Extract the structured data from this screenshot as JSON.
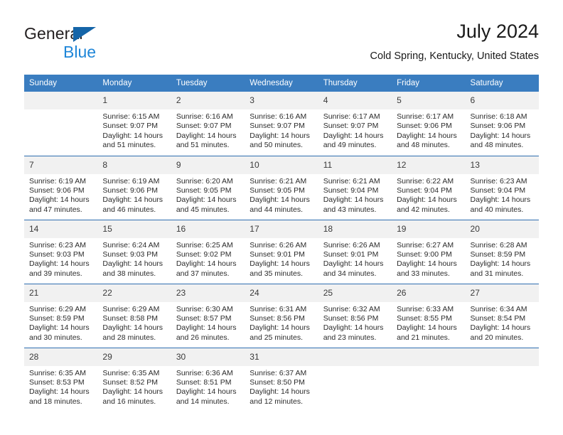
{
  "brand": {
    "name_part1": "General",
    "name_part2": "Blue",
    "triangle_color": "#1565a8",
    "blue_color": "#1f86d8"
  },
  "header": {
    "title": "July 2024",
    "subtitle": "Cold Spring, Kentucky, United States"
  },
  "theme": {
    "header_bg": "#3a7dc0",
    "row_divider": "#2f6eb0",
    "daynum_bg": "#f1f1f1",
    "text": "#2b2b2b"
  },
  "calendar": {
    "weekday_headers": [
      "Sunday",
      "Monday",
      "Tuesday",
      "Wednesday",
      "Thursday",
      "Friday",
      "Saturday"
    ],
    "weeks": [
      [
        {
          "day": "",
          "sunrise": "",
          "sunset": "",
          "daylight_line1": "",
          "daylight_line2": "",
          "empty": true
        },
        {
          "day": "1",
          "sunrise": "Sunrise: 6:15 AM",
          "sunset": "Sunset: 9:07 PM",
          "daylight_line1": "Daylight: 14 hours",
          "daylight_line2": "and 51 minutes."
        },
        {
          "day": "2",
          "sunrise": "Sunrise: 6:16 AM",
          "sunset": "Sunset: 9:07 PM",
          "daylight_line1": "Daylight: 14 hours",
          "daylight_line2": "and 51 minutes."
        },
        {
          "day": "3",
          "sunrise": "Sunrise: 6:16 AM",
          "sunset": "Sunset: 9:07 PM",
          "daylight_line1": "Daylight: 14 hours",
          "daylight_line2": "and 50 minutes."
        },
        {
          "day": "4",
          "sunrise": "Sunrise: 6:17 AM",
          "sunset": "Sunset: 9:07 PM",
          "daylight_line1": "Daylight: 14 hours",
          "daylight_line2": "and 49 minutes."
        },
        {
          "day": "5",
          "sunrise": "Sunrise: 6:17 AM",
          "sunset": "Sunset: 9:06 PM",
          "daylight_line1": "Daylight: 14 hours",
          "daylight_line2": "and 48 minutes."
        },
        {
          "day": "6",
          "sunrise": "Sunrise: 6:18 AM",
          "sunset": "Sunset: 9:06 PM",
          "daylight_line1": "Daylight: 14 hours",
          "daylight_line2": "and 48 minutes."
        }
      ],
      [
        {
          "day": "7",
          "sunrise": "Sunrise: 6:19 AM",
          "sunset": "Sunset: 9:06 PM",
          "daylight_line1": "Daylight: 14 hours",
          "daylight_line2": "and 47 minutes."
        },
        {
          "day": "8",
          "sunrise": "Sunrise: 6:19 AM",
          "sunset": "Sunset: 9:06 PM",
          "daylight_line1": "Daylight: 14 hours",
          "daylight_line2": "and 46 minutes."
        },
        {
          "day": "9",
          "sunrise": "Sunrise: 6:20 AM",
          "sunset": "Sunset: 9:05 PM",
          "daylight_line1": "Daylight: 14 hours",
          "daylight_line2": "and 45 minutes."
        },
        {
          "day": "10",
          "sunrise": "Sunrise: 6:21 AM",
          "sunset": "Sunset: 9:05 PM",
          "daylight_line1": "Daylight: 14 hours",
          "daylight_line2": "and 44 minutes."
        },
        {
          "day": "11",
          "sunrise": "Sunrise: 6:21 AM",
          "sunset": "Sunset: 9:04 PM",
          "daylight_line1": "Daylight: 14 hours",
          "daylight_line2": "and 43 minutes."
        },
        {
          "day": "12",
          "sunrise": "Sunrise: 6:22 AM",
          "sunset": "Sunset: 9:04 PM",
          "daylight_line1": "Daylight: 14 hours",
          "daylight_line2": "and 42 minutes."
        },
        {
          "day": "13",
          "sunrise": "Sunrise: 6:23 AM",
          "sunset": "Sunset: 9:04 PM",
          "daylight_line1": "Daylight: 14 hours",
          "daylight_line2": "and 40 minutes."
        }
      ],
      [
        {
          "day": "14",
          "sunrise": "Sunrise: 6:23 AM",
          "sunset": "Sunset: 9:03 PM",
          "daylight_line1": "Daylight: 14 hours",
          "daylight_line2": "and 39 minutes."
        },
        {
          "day": "15",
          "sunrise": "Sunrise: 6:24 AM",
          "sunset": "Sunset: 9:03 PM",
          "daylight_line1": "Daylight: 14 hours",
          "daylight_line2": "and 38 minutes."
        },
        {
          "day": "16",
          "sunrise": "Sunrise: 6:25 AM",
          "sunset": "Sunset: 9:02 PM",
          "daylight_line1": "Daylight: 14 hours",
          "daylight_line2": "and 37 minutes."
        },
        {
          "day": "17",
          "sunrise": "Sunrise: 6:26 AM",
          "sunset": "Sunset: 9:01 PM",
          "daylight_line1": "Daylight: 14 hours",
          "daylight_line2": "and 35 minutes."
        },
        {
          "day": "18",
          "sunrise": "Sunrise: 6:26 AM",
          "sunset": "Sunset: 9:01 PM",
          "daylight_line1": "Daylight: 14 hours",
          "daylight_line2": "and 34 minutes."
        },
        {
          "day": "19",
          "sunrise": "Sunrise: 6:27 AM",
          "sunset": "Sunset: 9:00 PM",
          "daylight_line1": "Daylight: 14 hours",
          "daylight_line2": "and 33 minutes."
        },
        {
          "day": "20",
          "sunrise": "Sunrise: 6:28 AM",
          "sunset": "Sunset: 8:59 PM",
          "daylight_line1": "Daylight: 14 hours",
          "daylight_line2": "and 31 minutes."
        }
      ],
      [
        {
          "day": "21",
          "sunrise": "Sunrise: 6:29 AM",
          "sunset": "Sunset: 8:59 PM",
          "daylight_line1": "Daylight: 14 hours",
          "daylight_line2": "and 30 minutes."
        },
        {
          "day": "22",
          "sunrise": "Sunrise: 6:29 AM",
          "sunset": "Sunset: 8:58 PM",
          "daylight_line1": "Daylight: 14 hours",
          "daylight_line2": "and 28 minutes."
        },
        {
          "day": "23",
          "sunrise": "Sunrise: 6:30 AM",
          "sunset": "Sunset: 8:57 PM",
          "daylight_line1": "Daylight: 14 hours",
          "daylight_line2": "and 26 minutes."
        },
        {
          "day": "24",
          "sunrise": "Sunrise: 6:31 AM",
          "sunset": "Sunset: 8:56 PM",
          "daylight_line1": "Daylight: 14 hours",
          "daylight_line2": "and 25 minutes."
        },
        {
          "day": "25",
          "sunrise": "Sunrise: 6:32 AM",
          "sunset": "Sunset: 8:56 PM",
          "daylight_line1": "Daylight: 14 hours",
          "daylight_line2": "and 23 minutes."
        },
        {
          "day": "26",
          "sunrise": "Sunrise: 6:33 AM",
          "sunset": "Sunset: 8:55 PM",
          "daylight_line1": "Daylight: 14 hours",
          "daylight_line2": "and 21 minutes."
        },
        {
          "day": "27",
          "sunrise": "Sunrise: 6:34 AM",
          "sunset": "Sunset: 8:54 PM",
          "daylight_line1": "Daylight: 14 hours",
          "daylight_line2": "and 20 minutes."
        }
      ],
      [
        {
          "day": "28",
          "sunrise": "Sunrise: 6:35 AM",
          "sunset": "Sunset: 8:53 PM",
          "daylight_line1": "Daylight: 14 hours",
          "daylight_line2": "and 18 minutes."
        },
        {
          "day": "29",
          "sunrise": "Sunrise: 6:35 AM",
          "sunset": "Sunset: 8:52 PM",
          "daylight_line1": "Daylight: 14 hours",
          "daylight_line2": "and 16 minutes."
        },
        {
          "day": "30",
          "sunrise": "Sunrise: 6:36 AM",
          "sunset": "Sunset: 8:51 PM",
          "daylight_line1": "Daylight: 14 hours",
          "daylight_line2": "and 14 minutes."
        },
        {
          "day": "31",
          "sunrise": "Sunrise: 6:37 AM",
          "sunset": "Sunset: 8:50 PM",
          "daylight_line1": "Daylight: 14 hours",
          "daylight_line2": "and 12 minutes."
        },
        {
          "day": "",
          "sunrise": "",
          "sunset": "",
          "daylight_line1": "",
          "daylight_line2": "",
          "empty": true
        },
        {
          "day": "",
          "sunrise": "",
          "sunset": "",
          "daylight_line1": "",
          "daylight_line2": "",
          "empty": true
        },
        {
          "day": "",
          "sunrise": "",
          "sunset": "",
          "daylight_line1": "",
          "daylight_line2": "",
          "empty": true
        }
      ]
    ]
  }
}
